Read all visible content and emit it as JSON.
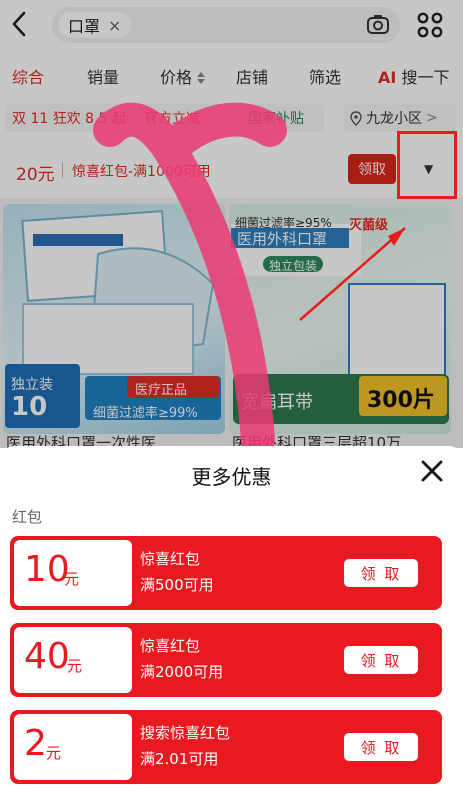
{
  "search": {
    "query": "口罩",
    "clear": "×"
  },
  "tabs": [
    {
      "label": "综合"
    },
    {
      "label": "销量"
    },
    {
      "label": "价格"
    },
    {
      "label": "店铺"
    },
    {
      "label": "筛选"
    },
    {
      "ai": "AI",
      "label": "搜一下"
    }
  ],
  "promo_chips": [
    {
      "label": "双 11 狂欢 8.5 起"
    },
    {
      "label": "官方立减"
    },
    {
      "label": "国家补贴"
    },
    {
      "label": "九龙小区",
      "suffix": ">"
    }
  ],
  "coupon_strip": {
    "amount": "20元",
    "text": "惊喜红包-满1000可用",
    "button": "领取"
  },
  "products": [
    {
      "title": "医用外科口罩一次性医",
      "image_text": [
        "独立装",
        "10",
        "医疗正品",
        "细菌过滤率≥99%"
      ]
    },
    {
      "title": "医用外科口罩三层超10万",
      "image_text": [
        "细菌过滤率≥95%",
        "灭菌级",
        "医用外科口罩",
        "独立包装",
        "宽扁耳带",
        "300片"
      ]
    }
  ],
  "sheet": {
    "title": "更多优惠",
    "section": "红包",
    "coupons": [
      {
        "amount": "10",
        "unit": "元",
        "name": "惊喜红包",
        "condition": "满500可用",
        "button": "领 取"
      },
      {
        "amount": "40",
        "unit": "元",
        "name": "惊喜红包",
        "condition": "满2000可用",
        "button": "领 取"
      },
      {
        "amount": "2",
        "unit": "元",
        "name": "搜索惊喜红包",
        "condition": "满2.01可用",
        "button": "领 取"
      }
    ]
  },
  "colors": {
    "brand_red": "#e8191f",
    "tab_active": "#e02e24",
    "highlight": "#e41e1e",
    "swoosh": "#ea3a72"
  }
}
